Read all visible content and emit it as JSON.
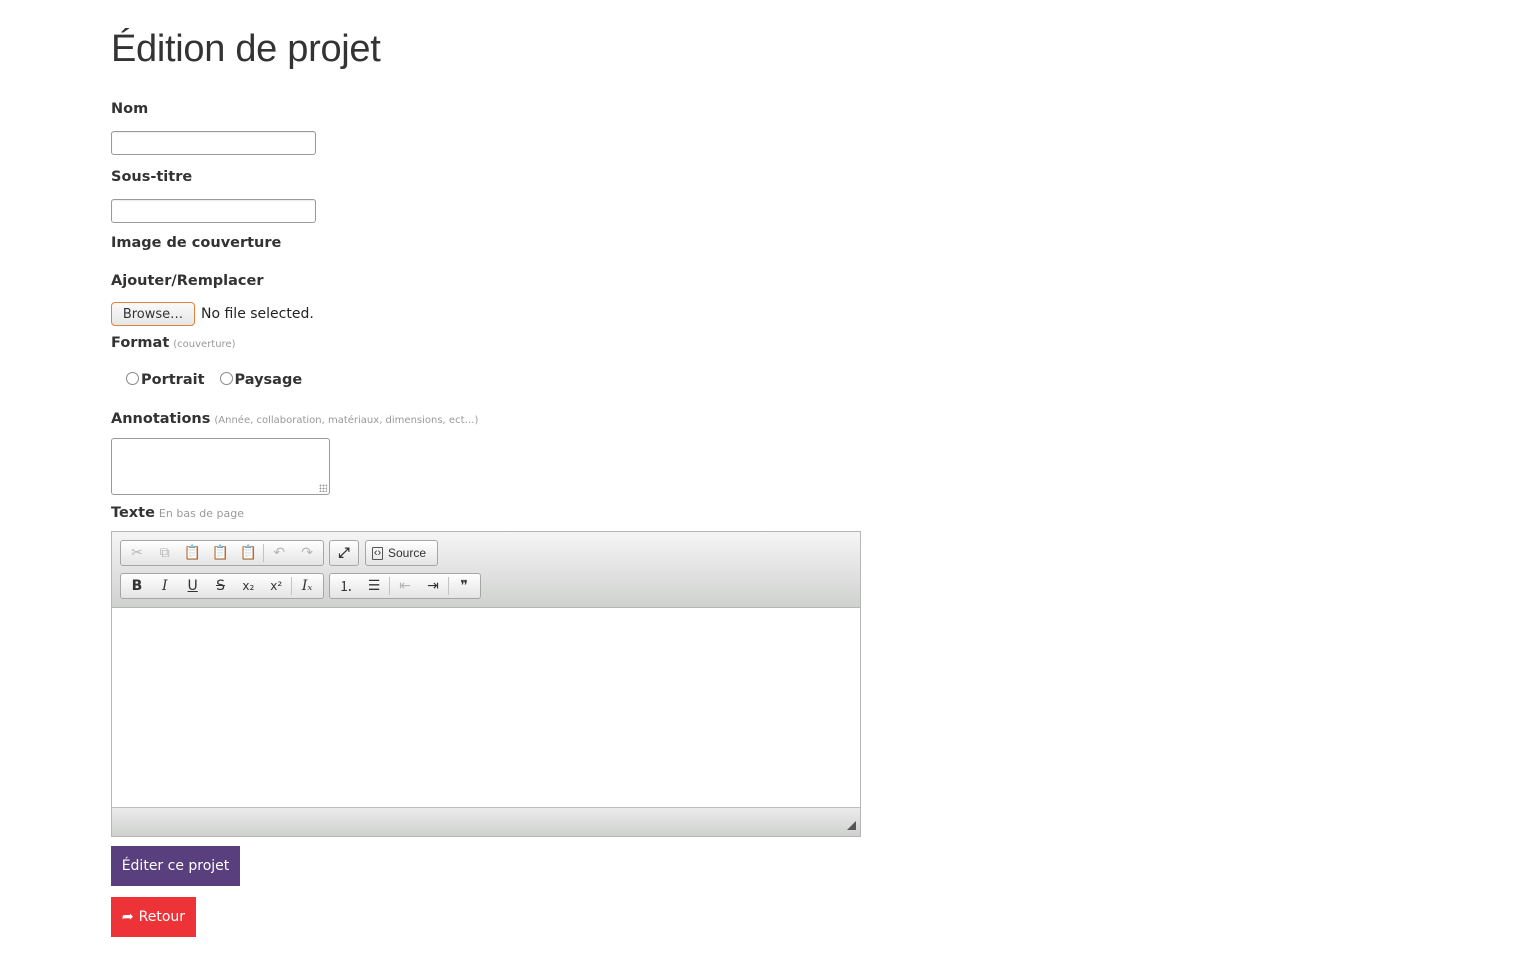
{
  "page": {
    "title": "Édition de projet"
  },
  "form": {
    "nom": {
      "label": "Nom",
      "value": ""
    },
    "sous_titre": {
      "label": "Sous-titre",
      "value": ""
    },
    "image": {
      "label": "Image de couverture"
    },
    "upload": {
      "label": "Ajouter/Remplacer",
      "browse_label": "Browse…",
      "status": "No file selected."
    },
    "format": {
      "label": "Format",
      "hint": "(couverture)",
      "options": [
        {
          "label": "Portrait",
          "selected": false
        },
        {
          "label": "Paysage",
          "selected": false
        }
      ]
    },
    "annotations": {
      "label": "Annotations",
      "hint": "(Année, collaboration, matériaux, dimensions, ect…)",
      "value": ""
    },
    "texte": {
      "label": "Texte",
      "hint": "En bas de page"
    }
  },
  "editor": {
    "toolbar": {
      "clipboard": [
        {
          "name": "cut-icon",
          "glyph": "✂",
          "enabled": false
        },
        {
          "name": "copy-icon",
          "glyph": "⧉",
          "enabled": false
        },
        {
          "name": "paste-icon",
          "glyph": "📋",
          "enabled": true
        },
        {
          "name": "paste-text-icon",
          "glyph": "📋",
          "enabled": true
        },
        {
          "name": "paste-word-icon",
          "glyph": "📋",
          "enabled": true
        }
      ],
      "history": [
        {
          "name": "undo-icon",
          "glyph": "↶",
          "enabled": false
        },
        {
          "name": "redo-icon",
          "glyph": "↷",
          "enabled": false
        }
      ],
      "maximize": {
        "name": "maximize-icon",
        "glyph": "⤢"
      },
      "source_label": "Source",
      "format": [
        {
          "name": "bold-icon",
          "glyph": "B"
        },
        {
          "name": "italic-icon",
          "glyph": "I"
        },
        {
          "name": "underline-icon",
          "glyph": "U"
        },
        {
          "name": "strikethrough-icon",
          "glyph": "S"
        },
        {
          "name": "subscript-icon",
          "glyph": "x₂"
        },
        {
          "name": "superscript-icon",
          "glyph": "x²"
        },
        {
          "name": "remove-format-icon",
          "glyph": "Iₓ"
        }
      ],
      "list": [
        {
          "name": "numbered-list-icon",
          "glyph": "⒈",
          "enabled": true
        },
        {
          "name": "bulleted-list-icon",
          "glyph": "☰",
          "enabled": true
        },
        {
          "name": "outdent-icon",
          "glyph": "⇤",
          "enabled": false
        },
        {
          "name": "indent-icon",
          "glyph": "⇥",
          "enabled": true
        },
        {
          "name": "blockquote-icon",
          "glyph": "❞",
          "enabled": true
        }
      ]
    },
    "content": ""
  },
  "actions": {
    "submit_label": "Éditer ce projet",
    "back_label": "Retour",
    "submit_color": "#5a3f7e",
    "back_color": "#ee3338"
  }
}
